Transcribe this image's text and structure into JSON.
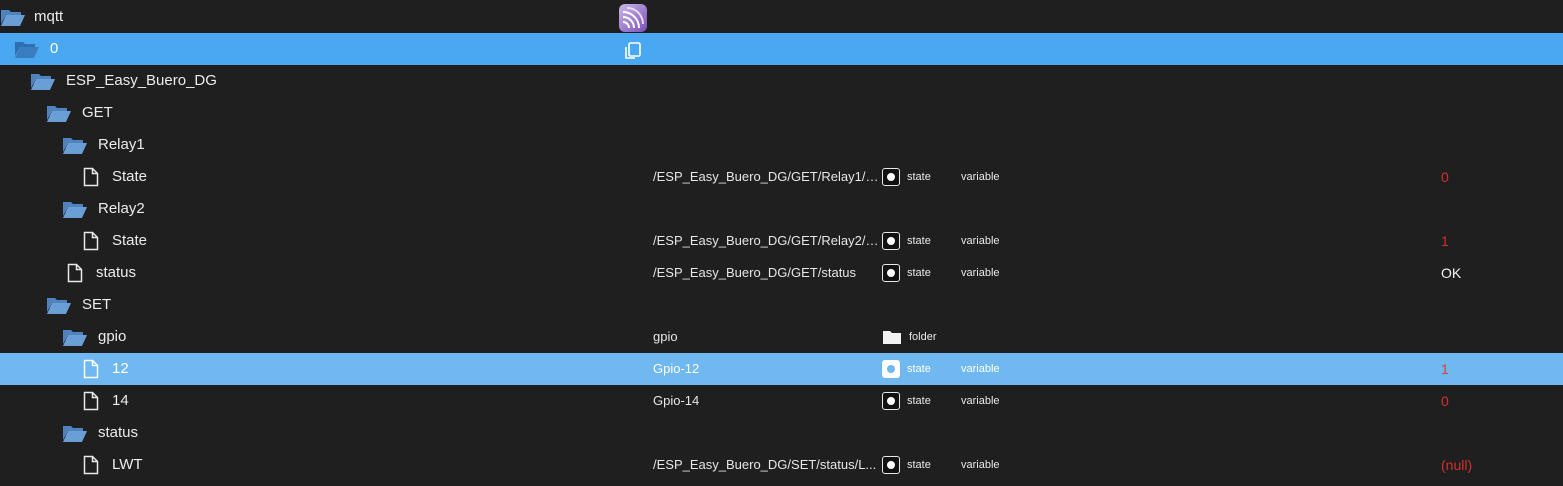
{
  "tree": {
    "root": {
      "name": "mqtt",
      "icon": "folder-open-icon"
    },
    "rows": [
      {
        "id": "0",
        "name": "0",
        "icon": "folder-open-icon"
      },
      {
        "id": "dev",
        "name": "ESP_Easy_Buero_DG",
        "icon": "folder-open-icon"
      },
      {
        "id": "get",
        "name": "GET",
        "icon": "folder-open-icon"
      },
      {
        "id": "relay1",
        "name": "Relay1",
        "icon": "folder-open-icon"
      },
      {
        "id": "relay1-state",
        "name": "State",
        "icon": "file-icon",
        "obj_name": "/ESP_Easy_Buero_DG/GET/Relay1/S...",
        "role": "state",
        "type": "variable",
        "value": "0"
      },
      {
        "id": "relay2",
        "name": "Relay2",
        "icon": "folder-open-icon"
      },
      {
        "id": "relay2-state",
        "name": "State",
        "icon": "file-icon",
        "obj_name": "/ESP_Easy_Buero_DG/GET/Relay2/S...",
        "role": "state",
        "type": "variable",
        "value": "1"
      },
      {
        "id": "get-status",
        "name": "status",
        "icon": "file-icon",
        "obj_name": "/ESP_Easy_Buero_DG/GET/status",
        "role": "state",
        "type": "variable",
        "value": "OK"
      },
      {
        "id": "set",
        "name": "SET",
        "icon": "folder-open-icon"
      },
      {
        "id": "gpio",
        "name": "gpio",
        "icon": "folder-open-icon",
        "obj_name": "gpio",
        "role": "folder"
      },
      {
        "id": "gpio-12",
        "name": "12",
        "icon": "file-icon",
        "obj_name": "Gpio-12",
        "role": "state",
        "type": "variable",
        "value": "1"
      },
      {
        "id": "gpio-14",
        "name": "14",
        "icon": "file-icon",
        "obj_name": "Gpio-14",
        "role": "state",
        "type": "variable",
        "value": "0"
      },
      {
        "id": "set-status",
        "name": "status",
        "icon": "folder-open-icon"
      },
      {
        "id": "lwt",
        "name": "LWT",
        "icon": "file-icon",
        "obj_name": "/ESP_Easy_Buero_DG/SET/status/L...",
        "role": "state",
        "type": "variable",
        "value": "(null)"
      }
    ]
  },
  "colors": {
    "background": "#1f1f1f",
    "selected_row": "#4aa8f2",
    "hover_row": "#6fb8f0",
    "value_red": "#d12f2f",
    "folder_icon": "#5a8ec8"
  },
  "adapter_logo": "mqtt-adapter-logo-icon",
  "copy_action": "copy-icon"
}
